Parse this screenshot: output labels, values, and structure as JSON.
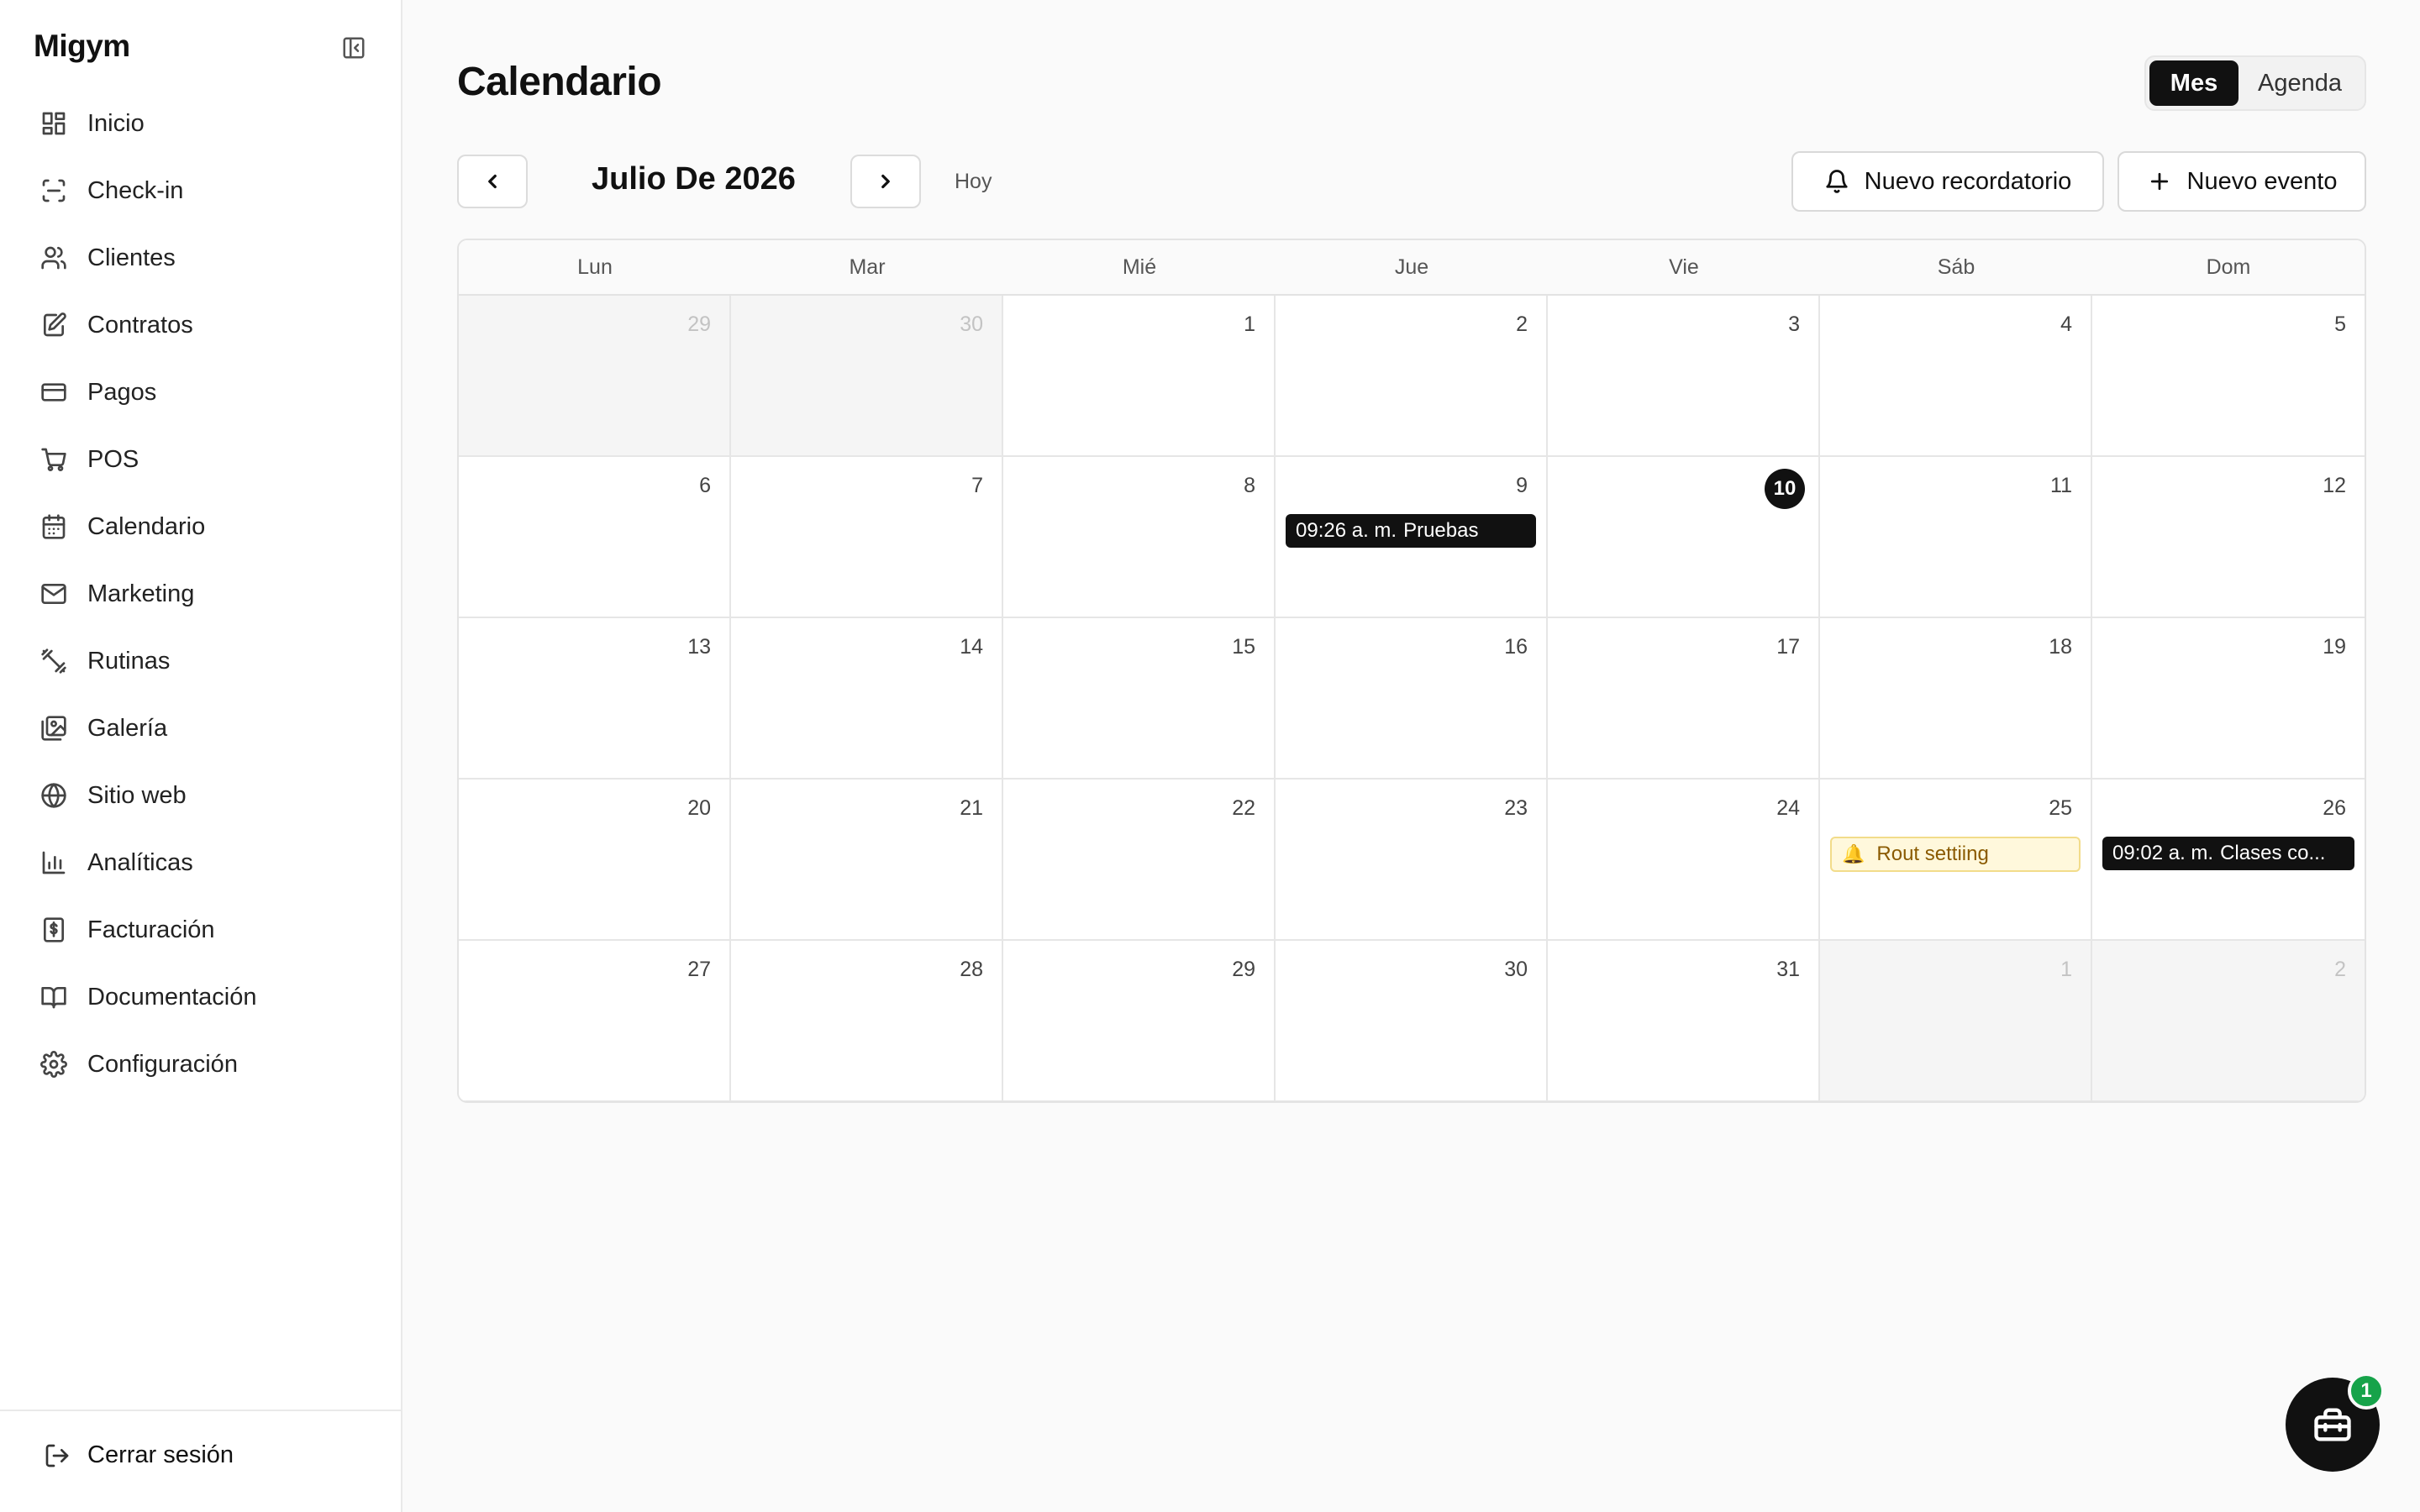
{
  "app": {
    "brand": "Migym"
  },
  "sidebar": {
    "items": [
      {
        "label": "Inicio",
        "icon": "dashboard-icon"
      },
      {
        "label": "Check-in",
        "icon": "scan-icon"
      },
      {
        "label": "Clientes",
        "icon": "users-icon"
      },
      {
        "label": "Contratos",
        "icon": "contract-icon"
      },
      {
        "label": "Pagos",
        "icon": "credit-card-icon"
      },
      {
        "label": "POS",
        "icon": "cart-icon"
      },
      {
        "label": "Calendario",
        "icon": "calendar-icon"
      },
      {
        "label": "Marketing",
        "icon": "mail-icon"
      },
      {
        "label": "Rutinas",
        "icon": "dumbbell-icon"
      },
      {
        "label": "Galería",
        "icon": "gallery-icon"
      },
      {
        "label": "Sitio web",
        "icon": "globe-icon"
      },
      {
        "label": "Analíticas",
        "icon": "bar-chart-icon"
      },
      {
        "label": "Facturación",
        "icon": "invoice-icon"
      },
      {
        "label": "Documentación",
        "icon": "book-icon"
      },
      {
        "label": "Configuración",
        "icon": "gear-icon"
      }
    ],
    "logout_label": "Cerrar sesión"
  },
  "header": {
    "title": "Calendario",
    "view_month": "Mes",
    "view_agenda": "Agenda"
  },
  "toolbar": {
    "month_label": "Julio De 2026",
    "today_label": "Hoy",
    "reminder_button": "Nuevo recordatorio",
    "event_button": "Nuevo evento"
  },
  "calendar": {
    "weekdays": [
      "Lun",
      "Mar",
      "Mié",
      "Jue",
      "Vie",
      "Sáb",
      "Dom"
    ],
    "weeks": [
      [
        {
          "day": "29",
          "out": true
        },
        {
          "day": "30",
          "out": true
        },
        {
          "day": "1"
        },
        {
          "day": "2"
        },
        {
          "day": "3"
        },
        {
          "day": "4"
        },
        {
          "day": "5"
        }
      ],
      [
        {
          "day": "6"
        },
        {
          "day": "7"
        },
        {
          "day": "8"
        },
        {
          "day": "9",
          "event": {
            "time": "09:26 a. m.",
            "title": "Pruebas"
          }
        },
        {
          "day": "10",
          "today": true
        },
        {
          "day": "11"
        },
        {
          "day": "12"
        }
      ],
      [
        {
          "day": "13"
        },
        {
          "day": "14"
        },
        {
          "day": "15"
        },
        {
          "day": "16"
        },
        {
          "day": "17"
        },
        {
          "day": "18"
        },
        {
          "day": "19"
        }
      ],
      [
        {
          "day": "20"
        },
        {
          "day": "21"
        },
        {
          "day": "22"
        },
        {
          "day": "23"
        },
        {
          "day": "24"
        },
        {
          "day": "25",
          "reminder": {
            "title": "Rout settiing"
          }
        },
        {
          "day": "26",
          "event": {
            "time": "09:02 a. m.",
            "title": "Clases co..."
          }
        }
      ],
      [
        {
          "day": "27"
        },
        {
          "day": "28"
        },
        {
          "day": "29"
        },
        {
          "day": "30"
        },
        {
          "day": "31"
        },
        {
          "day": "1",
          "out": true
        },
        {
          "day": "2",
          "out": true
        }
      ]
    ]
  },
  "fab": {
    "badge": "1",
    "icon": "toolbox-icon"
  },
  "colors": {
    "accent": "#111111",
    "reminder_bg": "#fff8dc",
    "reminder_text": "#8a5a00",
    "badge": "#16a34a"
  }
}
